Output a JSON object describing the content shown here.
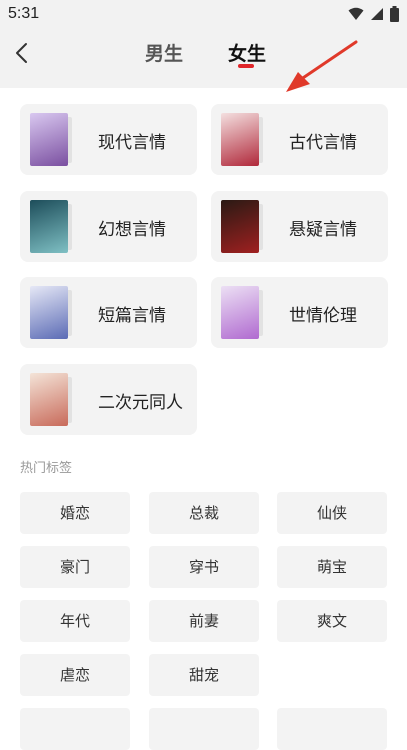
{
  "status": {
    "time": "5:31"
  },
  "header": {
    "tabs": [
      {
        "label": "男生",
        "active": false
      },
      {
        "label": "女生",
        "active": true
      }
    ],
    "accent_color": "#e0262a"
  },
  "categories": [
    {
      "label": "现代言情",
      "cover_colors": [
        "#d9c8f0",
        "#7a4fa0"
      ]
    },
    {
      "label": "古代言情",
      "cover_colors": [
        "#f4e0e0",
        "#b0283a"
      ]
    },
    {
      "label": "幻想言情",
      "cover_colors": [
        "#1d4d5a",
        "#7fc0c4"
      ]
    },
    {
      "label": "悬疑言情",
      "cover_colors": [
        "#2a1a14",
        "#a02020"
      ]
    },
    {
      "label": "短篇言情",
      "cover_colors": [
        "#e6e8f6",
        "#5b6bb5"
      ]
    },
    {
      "label": "世情伦理",
      "cover_colors": [
        "#ece0f4",
        "#b06ad0"
      ]
    },
    {
      "label": "二次元同人",
      "cover_colors": [
        "#f4e4d8",
        "#c86a5a"
      ]
    }
  ],
  "hot_tags": {
    "title": "热门标签",
    "items": [
      "婚恋",
      "总裁",
      "仙侠",
      "豪门",
      "穿书",
      "萌宝",
      "年代",
      "前妻",
      "爽文",
      "虐恋",
      "甜宠"
    ]
  }
}
